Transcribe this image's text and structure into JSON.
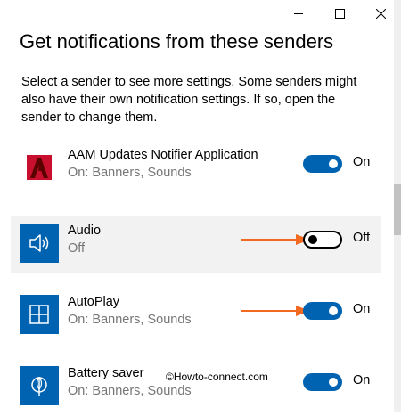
{
  "window": {
    "controls": [
      "minimize",
      "maximize",
      "close"
    ]
  },
  "page": {
    "heading": "Get notifications from these senders",
    "description": "Select a sender to see more settings. Some senders might also have their own notification settings. If so, open the sender to change them."
  },
  "senders": [
    {
      "name": "AAM Updates Notifier Application",
      "status": "On: Banners, Sounds",
      "toggle_state": "On",
      "enabled": true,
      "icon": "adobe-icon",
      "icon_color": "#c8102e"
    },
    {
      "name": "Audio",
      "status": "Off",
      "toggle_state": "Off",
      "enabled": false,
      "icon": "speaker-icon",
      "icon_color": "#0063b1"
    },
    {
      "name": "AutoPlay",
      "status": "On: Banners, Sounds",
      "toggle_state": "On",
      "enabled": true,
      "icon": "autoplay-icon",
      "icon_color": "#0063b1"
    },
    {
      "name": "Battery saver",
      "status": "On: Banners, Sounds",
      "toggle_state": "On",
      "enabled": true,
      "icon": "battery-saver-icon",
      "icon_color": "#0063b1"
    }
  ],
  "colors": {
    "accent": "#0063b1",
    "annotation_arrow": "#f26a21",
    "selected_row": "#f2f2f2"
  },
  "watermark": "©Howto-connect.com"
}
